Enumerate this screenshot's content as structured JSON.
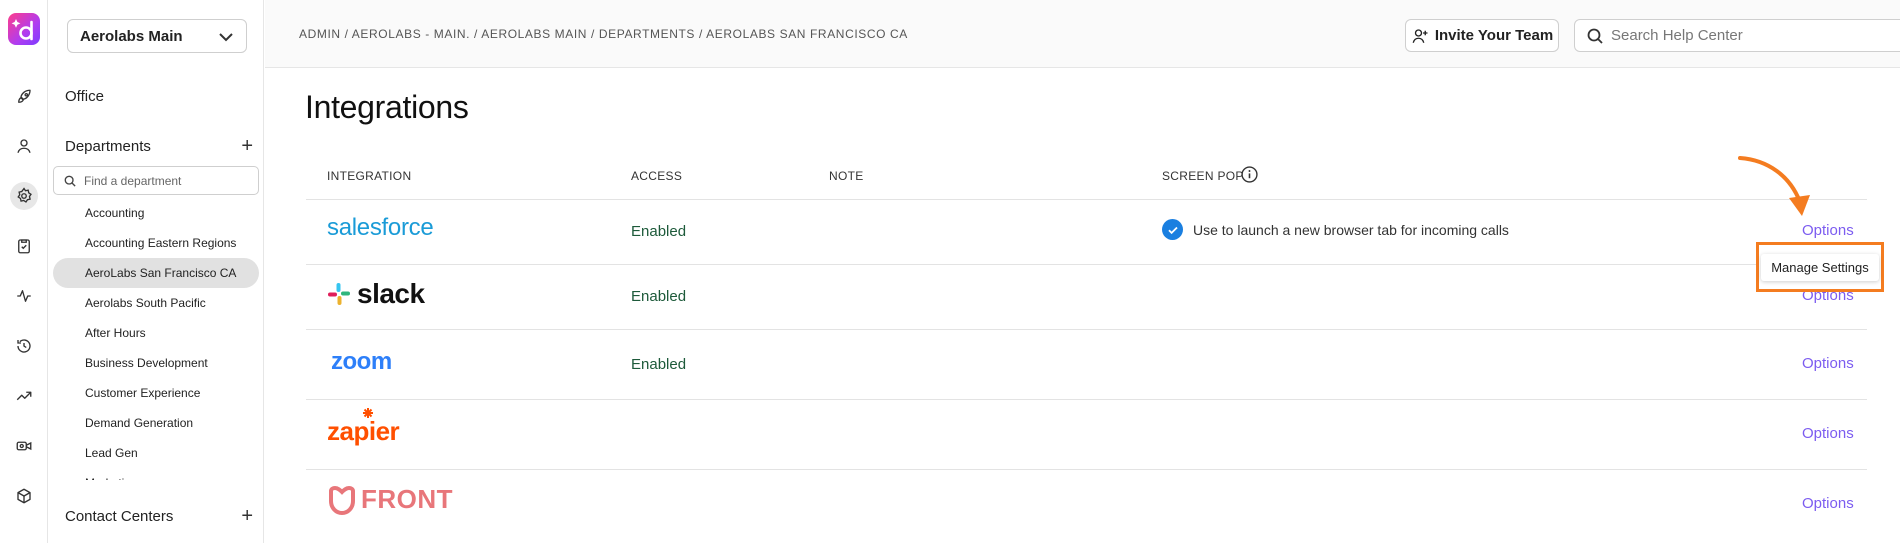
{
  "colors": {
    "accent_link": "#7c5cf0",
    "enabled_text": "#1d5a3a",
    "annotation": "#f47c20",
    "salesforce": "#1a9bd7",
    "zoom": "#2d7ff9",
    "zapier": "#ff4f00",
    "front": "#e8767a",
    "check": "#1a7fe0"
  },
  "rail": {
    "items": [
      {
        "icon": "rocket-icon"
      },
      {
        "icon": "person-icon"
      },
      {
        "icon": "gear-icon",
        "active": true
      },
      {
        "icon": "clipboard-icon"
      },
      {
        "icon": "activity-icon"
      },
      {
        "icon": "history-icon"
      },
      {
        "icon": "trend-icon"
      },
      {
        "icon": "video-icon"
      },
      {
        "icon": "cube-icon"
      }
    ]
  },
  "sidebar": {
    "account": "Aerolabs Main",
    "office_label": "Office",
    "departments_label": "Departments",
    "dept_search_placeholder": "Find a department",
    "departments": [
      "Accounting",
      "Accounting Eastern Regions",
      "AeroLabs San Francisco CA",
      "Aerolabs South Pacific",
      "After Hours",
      "Business Development",
      "Customer Experience",
      "Demand Generation",
      "Lead Gen",
      "Marketing"
    ],
    "selected_department": "AeroLabs San Francisco CA",
    "contact_centers_label": "Contact Centers"
  },
  "topbar": {
    "breadcrumb": "ADMIN / AEROLABS - MAIN. / AEROLABS MAIN / DEPARTMENTS / AEROLABS SAN FRANCISCO CA",
    "invite_label": "Invite Your Team",
    "help_search_placeholder": "Search Help Center"
  },
  "main": {
    "title": "Integrations",
    "columns": {
      "integration": "INTEGRATION",
      "access": "ACCESS",
      "note": "NOTE",
      "screen_pop": "SCREEN POP"
    },
    "rows": [
      {
        "name": "salesforce",
        "logo_text": "salesforce",
        "access": "Enabled",
        "screen_pop": "Use to launch a new browser tab for incoming calls",
        "options": "Options"
      },
      {
        "name": "slack",
        "logo_text": "slack",
        "access": "Enabled",
        "screen_pop": "",
        "options": "Options"
      },
      {
        "name": "zoom",
        "logo_text": "zoom",
        "access": "Enabled",
        "screen_pop": "",
        "options": "Options"
      },
      {
        "name": "zapier",
        "logo_text": "zapier",
        "access": "",
        "screen_pop": "",
        "options": "Options"
      },
      {
        "name": "front",
        "logo_text": "FRONT",
        "access": "",
        "screen_pop": "",
        "options": "Options"
      }
    ],
    "menu_item": "Manage Settings"
  }
}
